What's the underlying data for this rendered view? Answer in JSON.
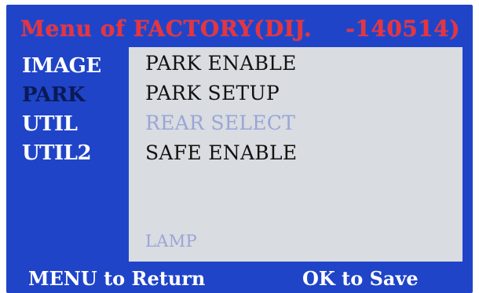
{
  "header": {
    "title_left": "Menu of  FACTORY(DIJ.",
    "title_right": "-140514)"
  },
  "sidebar": {
    "items": [
      {
        "label": "IMAGE",
        "active": false
      },
      {
        "label": "PARK",
        "active": true
      },
      {
        "label": "UTIL",
        "active": false
      },
      {
        "label": "UTIL2",
        "active": false
      }
    ]
  },
  "menu": {
    "items": [
      {
        "label": "PARK ENABLE",
        "enabled": true
      },
      {
        "label": "PARK SETUP",
        "enabled": true
      },
      {
        "label": "REAR SELECT",
        "enabled": false
      },
      {
        "label": "SAFE ENABLE",
        "enabled": true
      },
      {
        "label": "LAMP",
        "enabled": false
      }
    ]
  },
  "footer": {
    "return_hint": "MENU to Return",
    "save_hint": "OK to Save"
  },
  "colors": {
    "background": "#1f44c8",
    "title": "#e8343c",
    "panel": "#d9dce0",
    "active_item": "#0b1a55",
    "disabled_item": "#9aa5d8"
  }
}
